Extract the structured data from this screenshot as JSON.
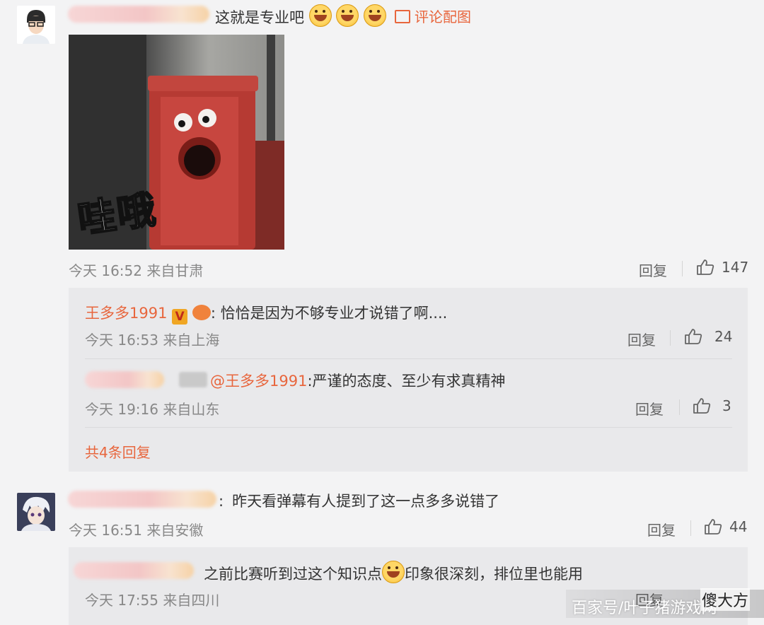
{
  "comment1": {
    "text": "这就是专业吧",
    "pic_link": "评论配图",
    "image_caption": "哇哦",
    "meta": "今天 16:52 来自甘肃",
    "reply_label": "回复",
    "likes": "147",
    "replies": [
      {
        "author": "王多多1991",
        "colon": ":",
        "text": "恰恰是因为不够专业才说错了啊....",
        "meta": "今天 16:53 来自上海",
        "reply_label": "回复",
        "likes": "24"
      },
      {
        "mention": "@王多多1991",
        "text": ":严谨的态度、至少有求真精神",
        "meta": "今天 19:16 来自山东",
        "reply_label": "回复",
        "likes": "3"
      }
    ],
    "more_replies": "共4条回复"
  },
  "comment2": {
    "colon": ":",
    "text": "昨天看弹幕有人提到了这一点多多说错了",
    "meta": "今天 16:51 来自安徽",
    "reply_label": "回复",
    "likes": "44",
    "reply": {
      "text_before": "之前比赛听到过这个知识点",
      "text_after": "印象很深刻，排位里也能用",
      "meta": "今天 17:55 来自四川",
      "reply_label": "回复"
    }
  },
  "watermark": "百家号/叶子猪游戏网",
  "watermark2": "傻大方",
  "colors": {
    "accent": "#e8663d",
    "panel": "#e9e9eb",
    "background": "#f3f3f4"
  },
  "icons": [
    "image-icon",
    "thumb-up-icon",
    "smile-emoji-icon",
    "verified-v-icon"
  ]
}
